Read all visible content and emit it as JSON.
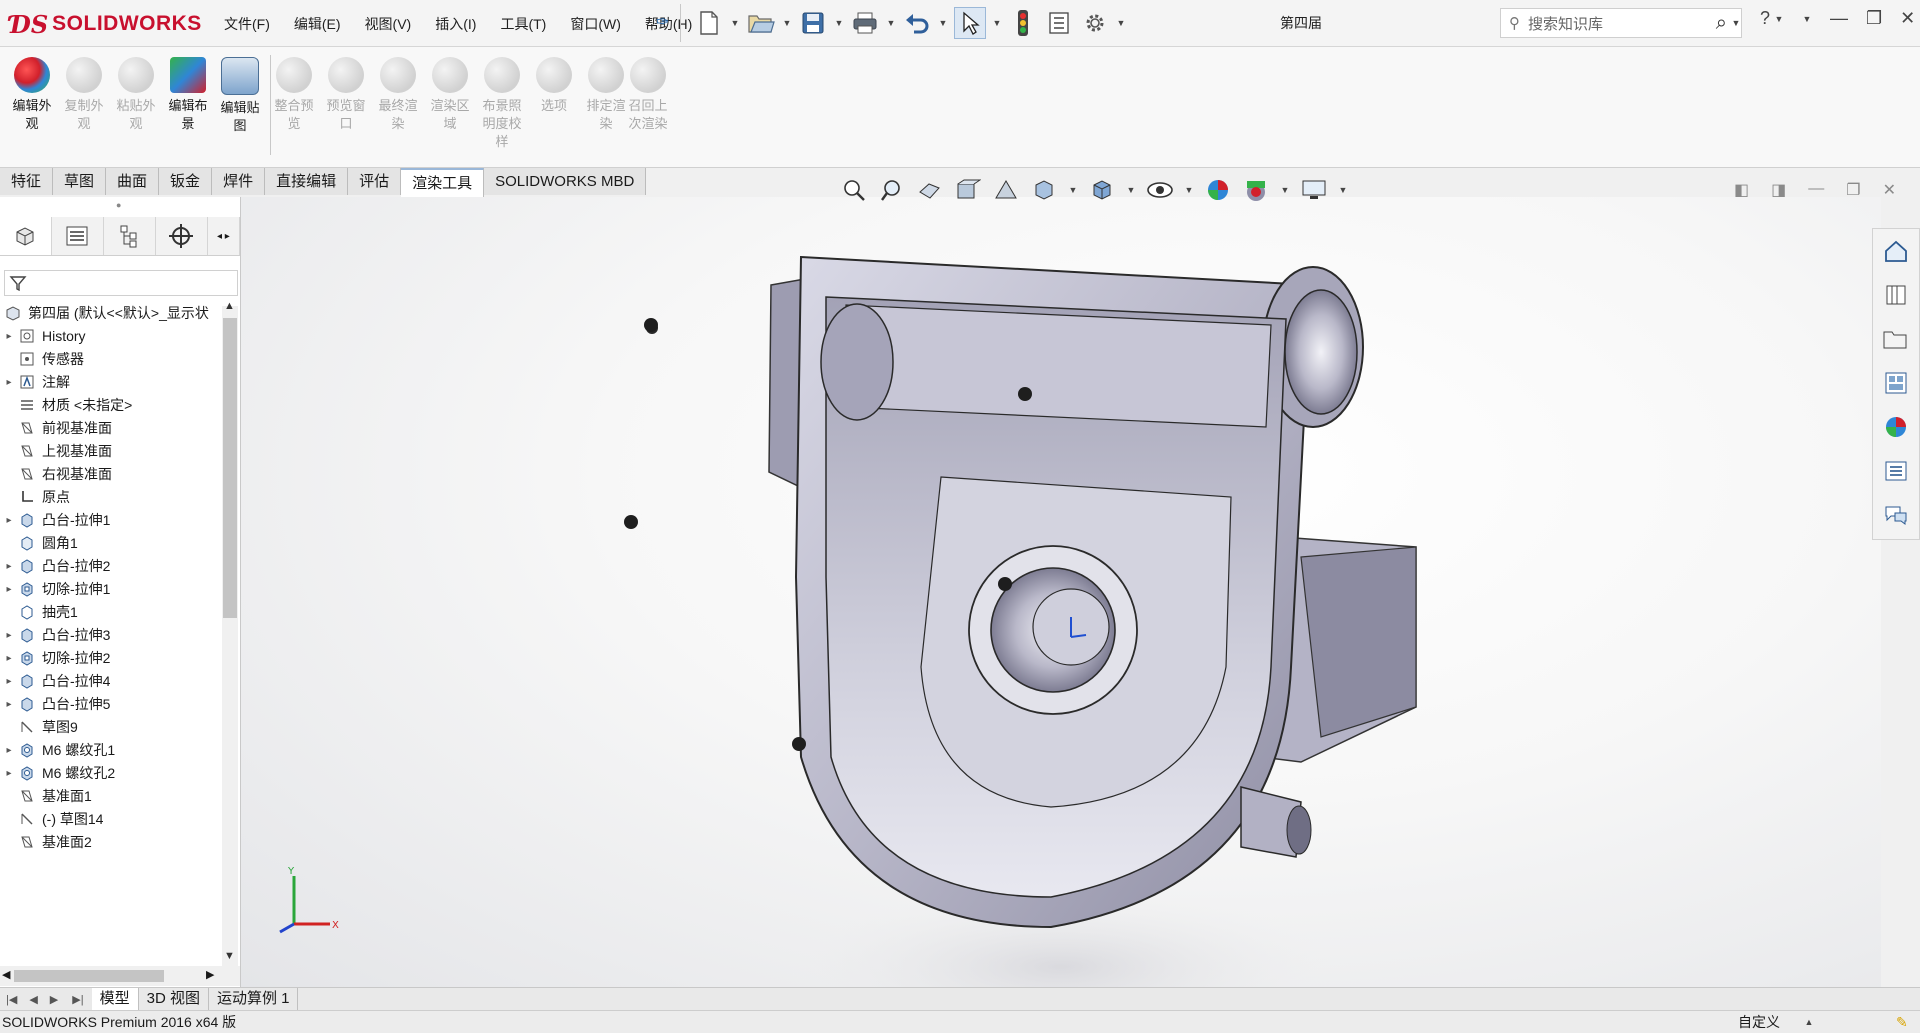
{
  "app": {
    "brand": "SOLIDWORKS",
    "document_title": "第四届"
  },
  "menu": [
    "文件(F)",
    "编辑(E)",
    "视图(V)",
    "插入(I)",
    "工具(T)",
    "窗口(W)",
    "帮助(H)"
  ],
  "search": {
    "placeholder": "搜索知识库"
  },
  "toolbar": {
    "tools": [
      {
        "label": "编辑外观",
        "enabled": true
      },
      {
        "label": "复制外观",
        "enabled": false
      },
      {
        "label": "粘贴外观",
        "enabled": false
      },
      {
        "label": "编辑布景",
        "enabled": true
      },
      {
        "label": "编辑贴图",
        "enabled": true
      },
      {
        "label": "整合预览",
        "enabled": false
      },
      {
        "label": "预览窗口",
        "enabled": false
      },
      {
        "label": "最终渲染",
        "enabled": false
      },
      {
        "label": "渲染区域",
        "enabled": false
      },
      {
        "label": "布景照明度校样",
        "enabled": false
      },
      {
        "label": "选项",
        "enabled": false
      },
      {
        "label": "排定渲染",
        "enabled": false
      },
      {
        "label": "召回上次渲染",
        "enabled": false
      }
    ]
  },
  "tabs": [
    "特征",
    "草图",
    "曲面",
    "钣金",
    "焊件",
    "直接编辑",
    "评估",
    "渲染工具",
    "SOLIDWORKS MBD"
  ],
  "active_tab": "渲染工具",
  "tree": {
    "root": "第四届 (默认<<默认>_显示状",
    "items": [
      {
        "label": "History",
        "expandable": true,
        "icon": "history-icon"
      },
      {
        "label": "传感器",
        "expandable": false,
        "icon": "sensor-icon"
      },
      {
        "label": "注解",
        "expandable": true,
        "icon": "annotation-icon"
      },
      {
        "label": "材质 <未指定>",
        "expandable": false,
        "icon": "material-icon"
      },
      {
        "label": "前视基准面",
        "expandable": false,
        "icon": "plane-icon"
      },
      {
        "label": "上视基准面",
        "expandable": false,
        "icon": "plane-icon"
      },
      {
        "label": "右视基准面",
        "expandable": false,
        "icon": "plane-icon"
      },
      {
        "label": "原点",
        "expandable": false,
        "icon": "origin-icon"
      },
      {
        "label": "凸台-拉伸1",
        "expandable": true,
        "icon": "extrude-icon"
      },
      {
        "label": "圆角1",
        "expandable": false,
        "icon": "fillet-icon"
      },
      {
        "label": "凸台-拉伸2",
        "expandable": true,
        "icon": "extrude-icon"
      },
      {
        "label": "切除-拉伸1",
        "expandable": true,
        "icon": "cut-icon"
      },
      {
        "label": "抽壳1",
        "expandable": false,
        "icon": "shell-icon"
      },
      {
        "label": "凸台-拉伸3",
        "expandable": true,
        "icon": "extrude-icon"
      },
      {
        "label": "切除-拉伸2",
        "expandable": true,
        "icon": "cut-icon"
      },
      {
        "label": "凸台-拉伸4",
        "expandable": true,
        "icon": "extrude-icon"
      },
      {
        "label": "凸台-拉伸5",
        "expandable": true,
        "icon": "extrude-icon"
      },
      {
        "label": "草图9",
        "expandable": false,
        "icon": "sketch-icon"
      },
      {
        "label": "M6 螺纹孔1",
        "expandable": true,
        "icon": "hole-icon"
      },
      {
        "label": "M6 螺纹孔2",
        "expandable": true,
        "icon": "hole-icon"
      },
      {
        "label": "基准面1",
        "expandable": false,
        "icon": "plane-icon"
      },
      {
        "label": "(-) 草图14",
        "expandable": false,
        "icon": "sketch-icon"
      },
      {
        "label": "基准面2",
        "expandable": false,
        "icon": "plane-icon"
      }
    ]
  },
  "bottom_tabs": [
    "模型",
    "3D 视图",
    "运动算例 1"
  ],
  "active_bottom_tab": "模型",
  "status": {
    "left": "SOLIDWORKS Premium 2016 x64 版",
    "right": "自定义"
  },
  "colors": {
    "brand_red": "#c8102e",
    "part_gray": "#b9b9c9",
    "accent_blue": "#2a6db3"
  }
}
